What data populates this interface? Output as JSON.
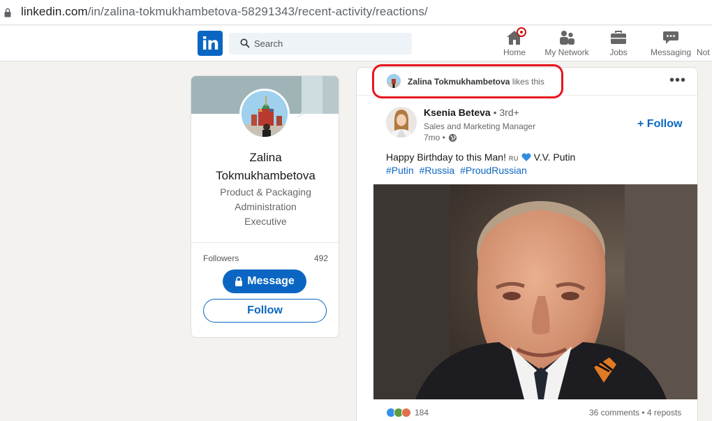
{
  "browser": {
    "url_host": "linkedin.com",
    "url_path": "/in/zalina-tokmukhambetova-58291343/recent-activity/reactions/"
  },
  "nav": {
    "logo": "in",
    "search_placeholder": "Search",
    "items": [
      {
        "label": "Home",
        "icon": "home-icon"
      },
      {
        "label": "My Network",
        "icon": "network-icon"
      },
      {
        "label": "Jobs",
        "icon": "briefcase-icon"
      },
      {
        "label": "Messaging",
        "icon": "messaging-icon"
      },
      {
        "label": "Not",
        "icon": "bell-icon"
      }
    ]
  },
  "profile": {
    "name": "Zalina Tokmukhambetova",
    "headline": "Product & Packaging Administration Executive",
    "followers_label": "Followers",
    "followers_count": "492",
    "message_label": "Message",
    "follow_label": "Follow"
  },
  "post": {
    "activity_actor": "Zalina Tokmukhambetova",
    "activity_verb": "likes this",
    "more_label": "•••",
    "author_name": "Ksenia Beteva",
    "author_degree": "• 3rd+",
    "author_title": "Sales and Marketing Manager",
    "time": "7mo •",
    "follow_label": "+ Follow",
    "text": "Happy Birthday to this Man!",
    "flag_tag": "RU",
    "text_after": "V.V. Putin",
    "hashtags": [
      "#Putin",
      "#Russia",
      "#ProudRussian"
    ],
    "reaction_count": "184",
    "comments": "36 comments",
    "reposts": "4 reposts",
    "counts_separator": "•"
  },
  "colors": {
    "brand": "#0a66c2",
    "highlight": "#e8141e"
  }
}
